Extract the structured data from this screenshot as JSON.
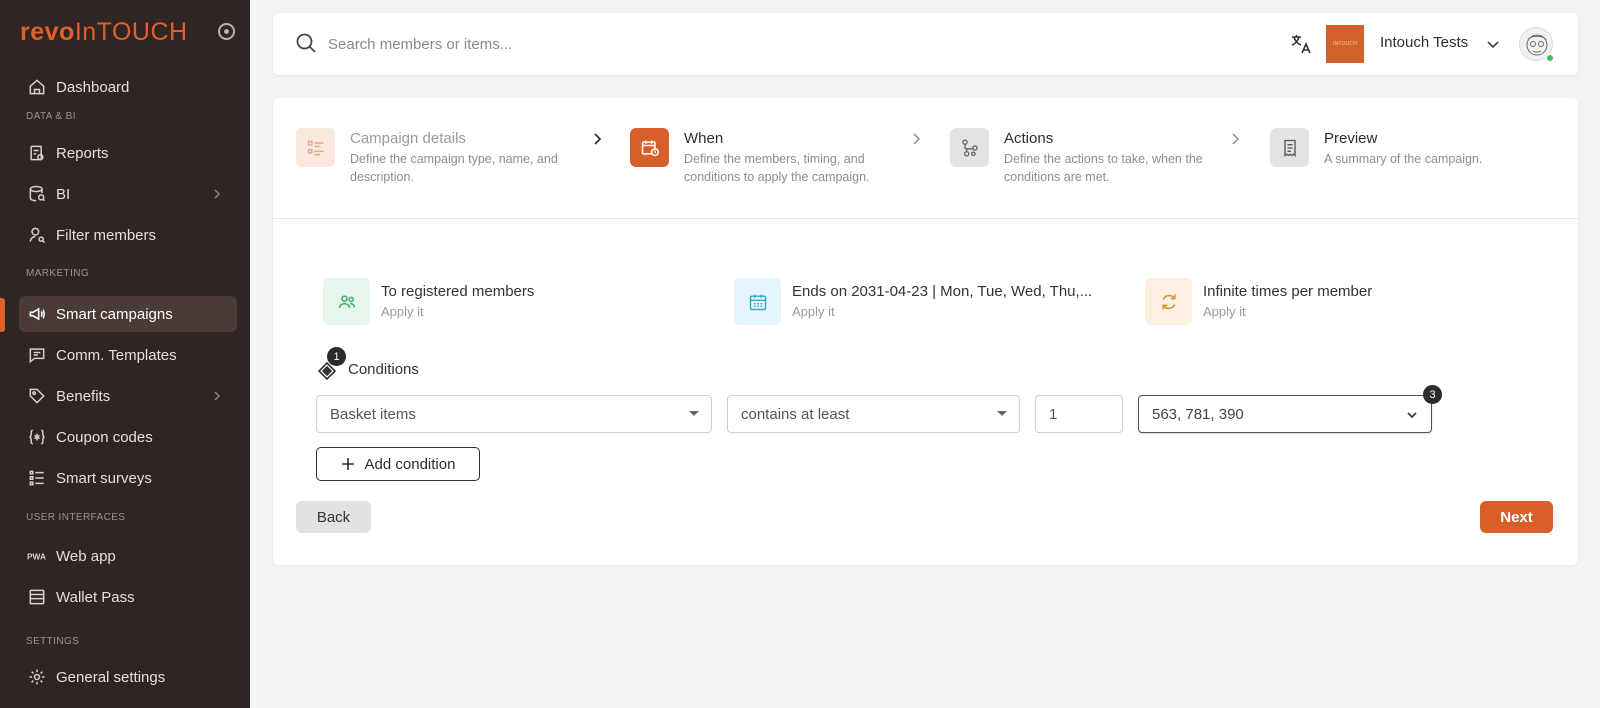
{
  "brand": {
    "part1": "revo",
    "part2": "InTOUCH"
  },
  "sidebar": {
    "sections": {
      "data_bi": "DATA & BI",
      "marketing": "MARKETING",
      "user_interfaces": "USER INTERFACES",
      "settings": "SETTINGS"
    },
    "items": [
      {
        "label": "Dashboard",
        "icon": "home-icon"
      },
      {
        "label": "Reports",
        "icon": "report-icon"
      },
      {
        "label": "BI",
        "icon": "database-search-icon"
      },
      {
        "label": "Filter members",
        "icon": "user-search-icon"
      },
      {
        "label": "Smart campaigns",
        "icon": "megaphone-icon",
        "active": true
      },
      {
        "label": "Comm. Templates",
        "icon": "message-icon"
      },
      {
        "label": "Benefits",
        "icon": "tag-icon"
      },
      {
        "label": "Coupon codes",
        "icon": "braces-asterisk-icon"
      },
      {
        "label": "Smart surveys",
        "icon": "checklist-icon"
      },
      {
        "label": "Web app",
        "icon": "pwa-icon"
      },
      {
        "label": "Wallet Pass",
        "icon": "wallet-icon"
      },
      {
        "label": "General settings",
        "icon": "gear-icon"
      }
    ]
  },
  "topbar": {
    "search_placeholder": "Search members or items...",
    "account_name": "Intouch Tests",
    "company_logo_text": "INTOUCH"
  },
  "steps": [
    {
      "title": "Campaign details",
      "desc": "Define the campaign type, name, and description.",
      "state": "done"
    },
    {
      "title": "When",
      "desc": "Define the members, timing, and conditions to apply the campaign.",
      "state": "active"
    },
    {
      "title": "Actions",
      "desc": "Define the actions to take, when the conditions are met.",
      "state": "pending"
    },
    {
      "title": "Preview",
      "desc": "A summary of the campaign.",
      "state": "pending"
    }
  ],
  "summary_cards": [
    {
      "title": "To registered members",
      "sub": "Apply it",
      "icon": "users-icon",
      "color": "#3fa96a",
      "bg": "#e6f6ec"
    },
    {
      "title": "Ends on 2031-04-23 | Mon, Tue, Wed, Thu,...",
      "sub": "Apply it",
      "icon": "calendar-icon",
      "color": "#3aa6c7",
      "bg": "#e4f5fb"
    },
    {
      "title": "Infinite times per member",
      "sub": "Apply it",
      "icon": "refresh-icon",
      "color": "#e08a2e",
      "bg": "#fdefe2"
    }
  ],
  "conditions": {
    "label": "Conditions",
    "count_badge": "1",
    "field": "Basket items",
    "operator": "contains at least",
    "quantity": "1",
    "items": "563, 781, 390",
    "items_badge": "3",
    "add_label": "Add condition"
  },
  "footer": {
    "back_label": "Back",
    "next_label": "Next"
  },
  "colors": {
    "accent": "#d85f2a",
    "sidebar_bg": "#2f2523"
  }
}
